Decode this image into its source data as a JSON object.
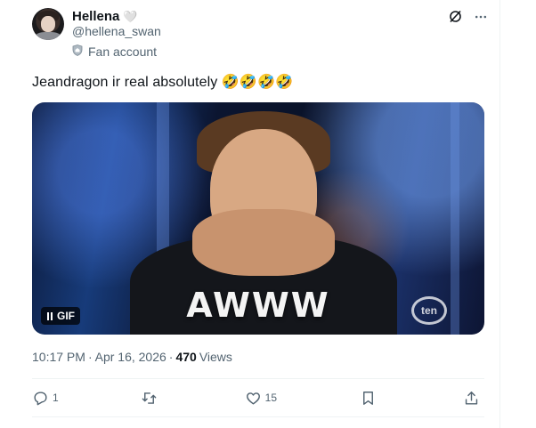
{
  "user": {
    "display_name": "Hellena",
    "name_emoji": "🤍",
    "handle": "@hellena_swan",
    "label": "Fan account"
  },
  "tweet": {
    "text": "Jeandragon ir real absolutely 🤣🤣🤣🤣"
  },
  "media": {
    "caption": "AWWW",
    "watermark": "ten",
    "badge": "GIF"
  },
  "meta": {
    "time": "10:17 PM",
    "separator": "·",
    "date": "Apr 16, 2026",
    "views_count": "470",
    "views_label": "Views"
  },
  "actions": {
    "reply_count": "1",
    "repost_count": "",
    "like_count": "15"
  },
  "icons": {
    "fan": "shield-icon",
    "grok": "grok-icon",
    "more": "more-icon",
    "reply": "reply-icon",
    "repost": "repost-icon",
    "like": "heart-icon",
    "bookmark": "bookmark-icon",
    "share": "share-icon"
  },
  "colors": {
    "text_primary": "#0f1419",
    "text_secondary": "#536471",
    "divider": "#eff3f4"
  }
}
